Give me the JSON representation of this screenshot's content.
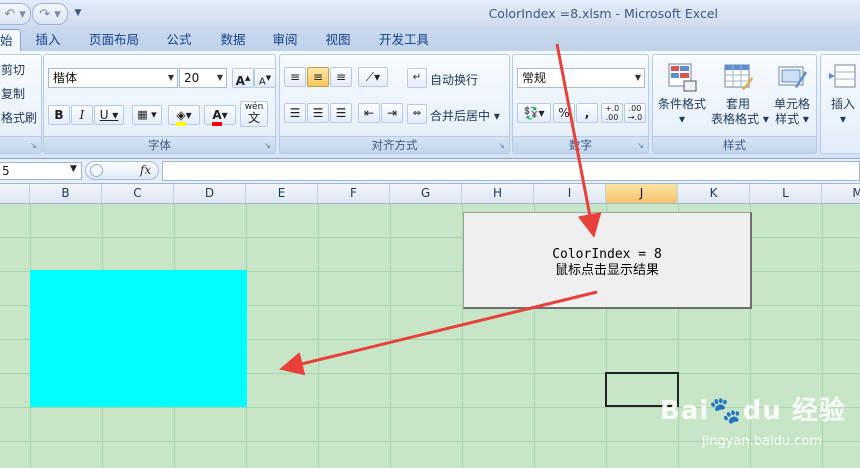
{
  "window": {
    "title": "ColorIndex =8.xlsm - Microsoft Excel"
  },
  "tabs": [
    {
      "label": "始"
    },
    {
      "label": "插入"
    },
    {
      "label": "页面布局"
    },
    {
      "label": "公式"
    },
    {
      "label": "数据"
    },
    {
      "label": "审阅"
    },
    {
      "label": "视图"
    },
    {
      "label": "开发工具"
    }
  ],
  "clipboard": {
    "cut": "剪切",
    "copy": "复制",
    "format_painter": "格式刷"
  },
  "font": {
    "name": "楷体",
    "size": "20",
    "group_label": "字体",
    "wen_label": "wén",
    "wen_char": "文"
  },
  "alignment": {
    "wrap_text": "自动换行",
    "merge_center": "合并后居中",
    "group_label": "对齐方式"
  },
  "number": {
    "format": "常规",
    "group_label": "数字",
    "percent": "%",
    "comma": ",",
    "inc_decimal": "+.0\n.00",
    "dec_decimal": ".00\n→.0"
  },
  "styles": {
    "conditional_format": "条件格式",
    "table_format_1": "套用",
    "table_format_2": "表格格式",
    "cell_style_1": "单元格",
    "cell_style_2": "样式",
    "group_label": "样式"
  },
  "cells": {
    "insert": "插入"
  },
  "formula_bar": {
    "name_box": "5",
    "fx": "fx",
    "value": ""
  },
  "columns": [
    "B",
    "C",
    "D",
    "E",
    "F",
    "G",
    "H",
    "I",
    "J",
    "K",
    "L",
    "M"
  ],
  "active_column": "J",
  "command_button": {
    "line1": "ColorIndex = 8",
    "line2": "鼠标点击显示结果"
  },
  "shape": {
    "fill": "#00ffff",
    "colorindex": 8
  },
  "annotations": {
    "arrow_color": "#e8413b"
  },
  "watermark": {
    "brand": "Bai🐾du 经验",
    "url": "jingyan.baidu.com"
  },
  "colors": {
    "sheet_bg": "#c7e6c7",
    "grid_line": "#a9d3aa",
    "ribbon_text": "#15428b"
  }
}
